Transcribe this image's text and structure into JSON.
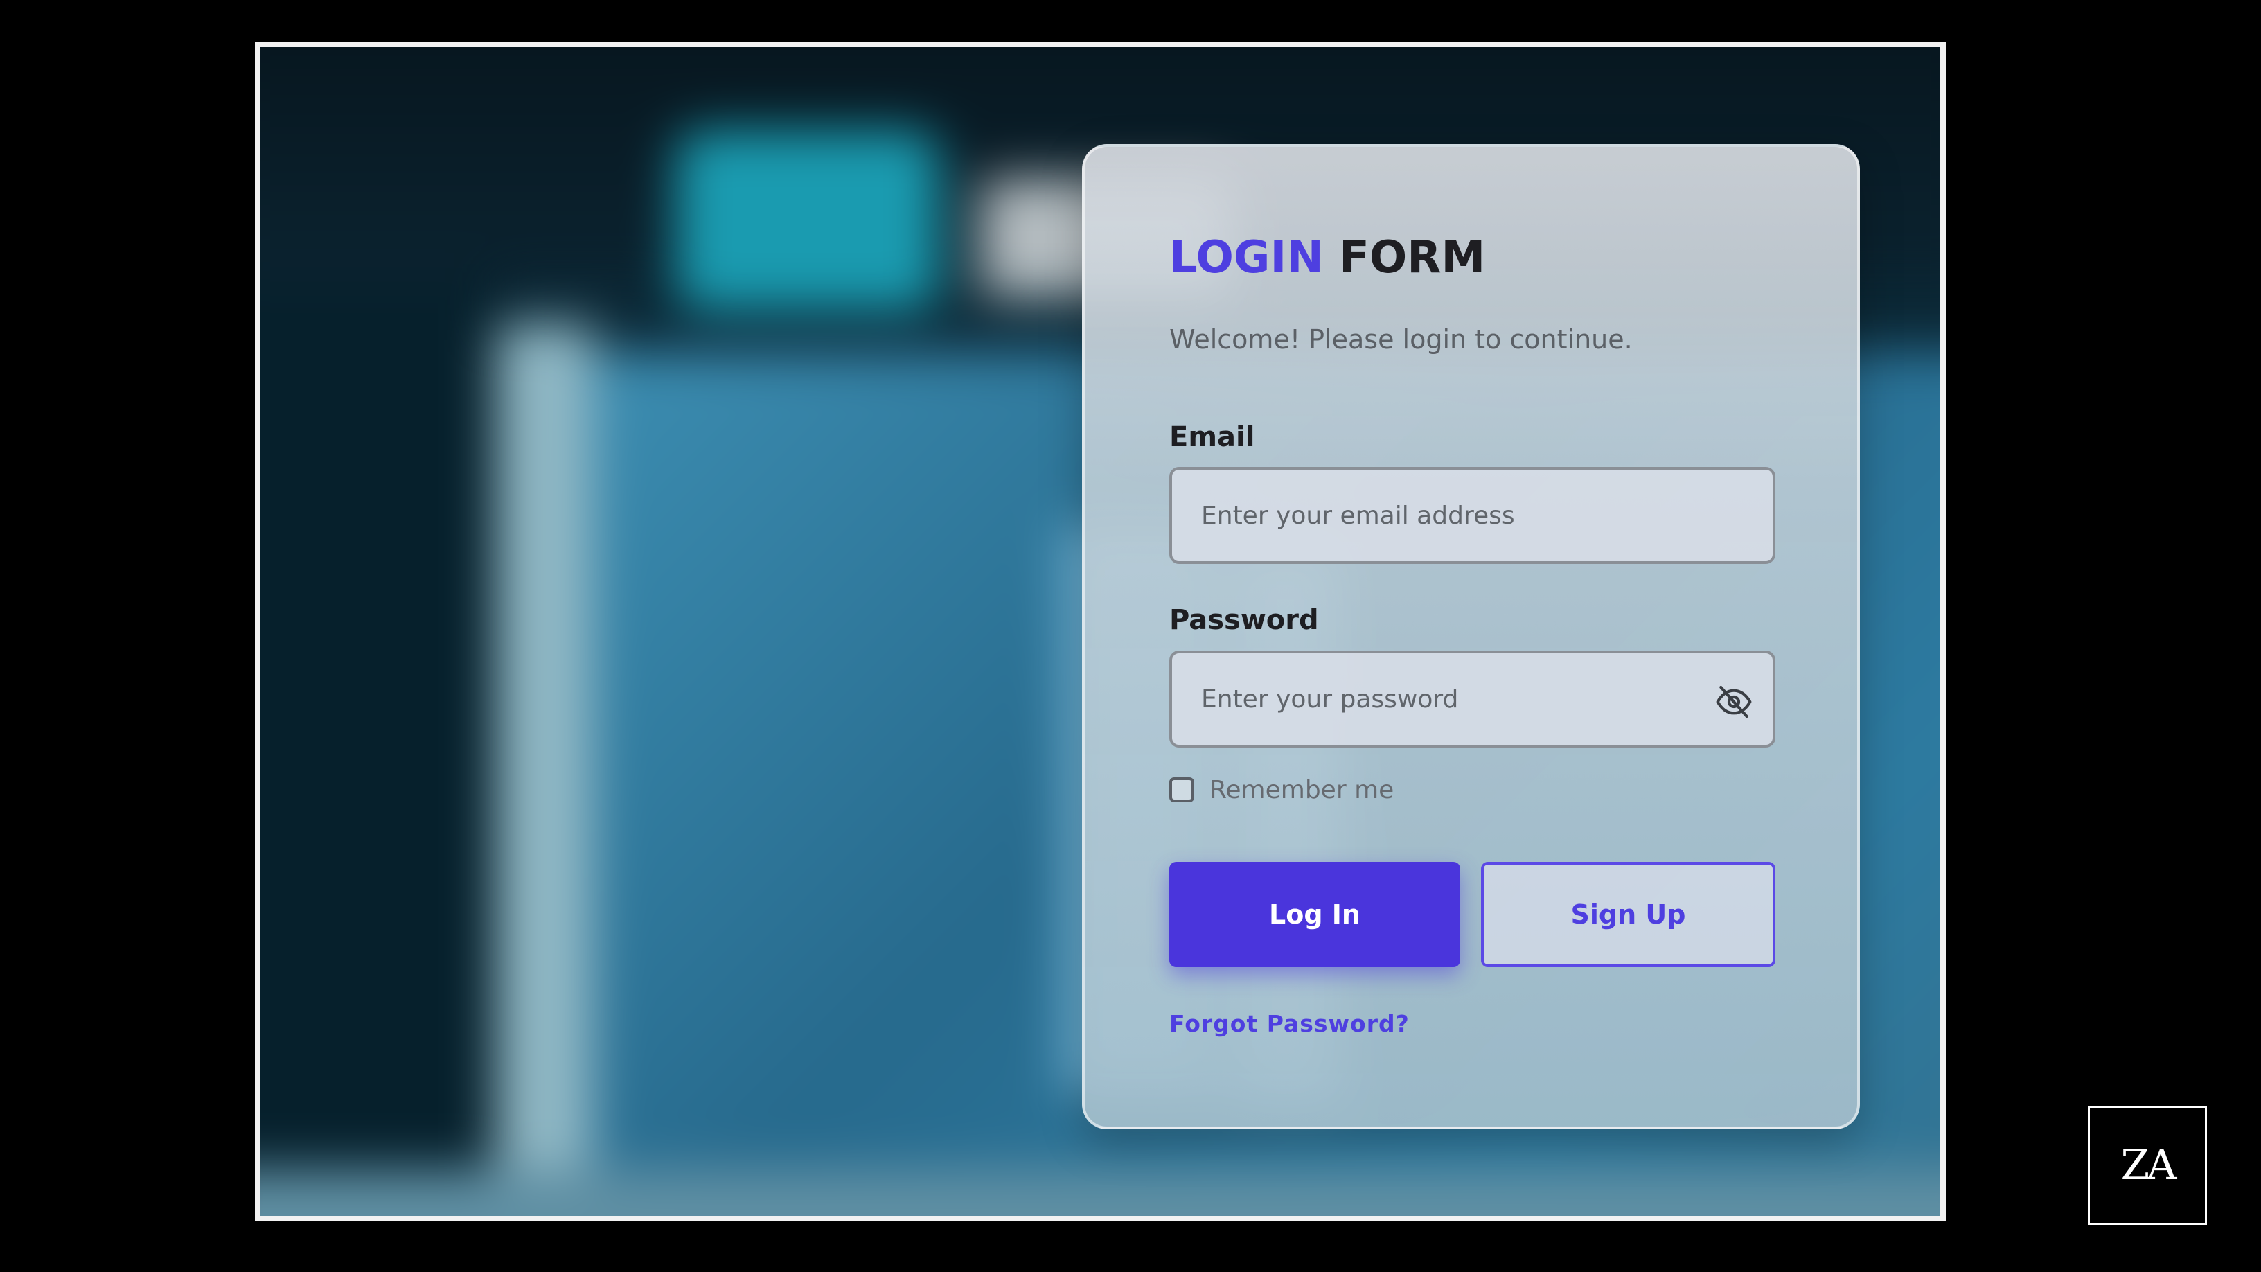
{
  "form": {
    "title_accent": "LOGIN",
    "title_rest": "FORM",
    "subtitle": "Welcome! Please login to continue.",
    "email": {
      "label": "Email",
      "placeholder": "Enter your email address",
      "value": ""
    },
    "password": {
      "label": "Password",
      "placeholder": "Enter your password",
      "value": "",
      "visibility_icon": "eye-off-icon"
    },
    "remember": {
      "label": "Remember me",
      "checked": false
    },
    "login_button": "Log In",
    "signup_button": "Sign Up",
    "forgot_link": "Forgot Password?"
  },
  "brand": {
    "badge_text": "ZA"
  },
  "colors": {
    "accent": "#4a35dc",
    "page_background": "#000000",
    "frame_border": "#f2f2f2"
  }
}
